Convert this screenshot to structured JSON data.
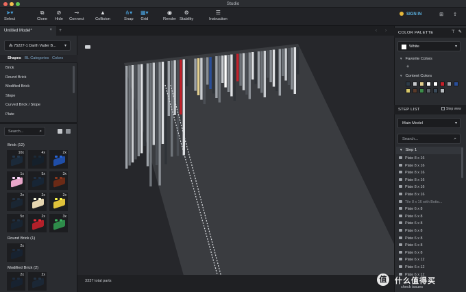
{
  "window": {
    "title": "Studio"
  },
  "toolbar": {
    "tools": [
      {
        "label": "Select",
        "icon": "cursor-icon"
      },
      {
        "label": "Clone",
        "icon": "clone-icon"
      },
      {
        "label": "Hide",
        "icon": "eye-slash-icon"
      },
      {
        "label": "Connect",
        "icon": "connect-icon"
      },
      {
        "label": "Collision",
        "icon": "warning-icon"
      },
      {
        "label": "Snap",
        "icon": "snap-icon"
      },
      {
        "label": "Grid",
        "icon": "grid-icon"
      },
      {
        "label": "Render",
        "icon": "camera-icon"
      },
      {
        "label": "Stability",
        "icon": "stability-icon"
      },
      {
        "label": "Instruction",
        "icon": "instruction-icon"
      }
    ],
    "sign_in": "SIGN IN"
  },
  "left_panel": {
    "doc_tab": "Untitled Model*",
    "model_select": "75227-1 Darth Vader B...",
    "category_tabs": [
      "Shapes",
      "BL Categories",
      "Colors"
    ],
    "categories": [
      "Brick",
      "Round Brick",
      "Modified Brick",
      "Slope",
      "Curved Brick / Slope",
      "Plate"
    ],
    "search_placeholder": "Search...",
    "groups": [
      {
        "title": "Brick (12)",
        "counts": [
          "10x",
          "4x",
          "2x",
          "1x",
          "5x",
          "3x",
          "2x",
          "2x",
          "2x",
          "5x",
          "2x",
          "3x"
        ],
        "colors": [
          "#1b2a3a",
          "#15202b",
          "#1f4ea8",
          "#e8a6c9",
          "#172535",
          "#6b2a16",
          "#1a2633",
          "#e6d6b0",
          "#e0c23a",
          "#182431",
          "#b3202a",
          "#2e8c4a"
        ]
      },
      {
        "title": "Round Brick (1)",
        "counts": [
          "2x"
        ],
        "colors": [
          "#172230"
        ]
      },
      {
        "title": "Modified Brick (2)",
        "counts": [
          "2x",
          "2x"
        ],
        "colors": [
          "#172230",
          "#1b2735"
        ]
      }
    ]
  },
  "viewport": {
    "status": "3337 total parts"
  },
  "right_panel": {
    "color_palette": {
      "title": "COLOR PALETTE",
      "selected": "White",
      "selected_hex": "#ffffff",
      "favorite_title": "Favorite Colors",
      "add_label": "+",
      "content_title": "Content Colors",
      "content_colors": [
        "#2d3b48",
        "#c7c9cc",
        "#e3cf8f",
        "#f2f2f2",
        "#ffffff",
        "#c4202a",
        "#9aa0a6",
        "#2a4f9a",
        "#d8c86a",
        "#5a3a2a",
        "#3d8c4a",
        "#5b6168",
        "#3a4a5a",
        "#b8bcc0"
      ]
    },
    "step_list": {
      "title": "STEP LIST",
      "step_view": "Step view",
      "model": "Main Model",
      "search_placeholder": "Search...",
      "step": "Step 1",
      "items": [
        "Plate 8 x 16",
        "Plate 8 x 16",
        "Plate 8 x 16",
        "Plate 8 x 16",
        "Plate 8 x 16",
        "Plate 8 x 16",
        "Tile 8 x 16 with Botto...",
        "Plate 6 x 8",
        "Plate 6 x 8",
        "Plate 6 x 8",
        "Plate 6 x 8",
        "Plate 6 x 8",
        "Plate 6 x 8",
        "Plate 6 x 8",
        "Plate 6 x 12",
        "Plate 6 x 12",
        "Plate 6 x 12"
      ],
      "check_issues": "check issues"
    }
  },
  "watermark": {
    "icon_text": "值",
    "text": "什么值得买"
  }
}
